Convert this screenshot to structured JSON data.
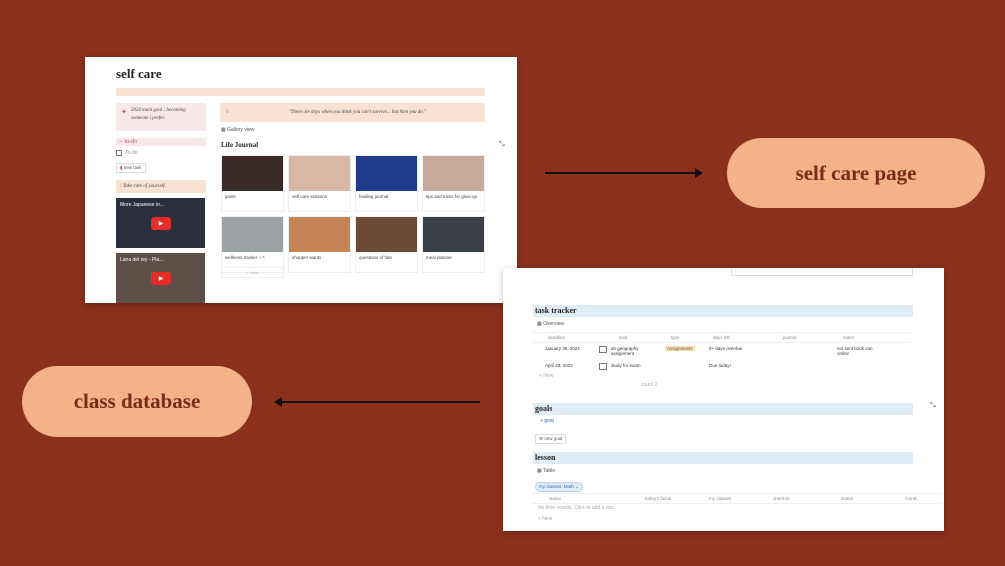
{
  "callouts": {
    "self_care_page": "self care page",
    "class_database": "class database"
  },
  "self_care": {
    "title": "self care",
    "goal_text": "2024 main goal : becoming someone i prefer.",
    "todo_heading": "to-do",
    "todo_item": "To-do",
    "new_task": "new task",
    "take_care": "Take care of yourself.",
    "videos": [
      {
        "title": "More Japanese in..."
      },
      {
        "title": "Lana del rey - Pla..."
      }
    ],
    "quote": "\"There are days when you think you can't survive... but then you do.\"",
    "gallery_view": "Gallery view",
    "life_journal": "Life Journal",
    "gallery": [
      {
        "caption": "goals",
        "color": "#3a2a26"
      },
      {
        "caption": "self care seasons",
        "color": "#d9b7a4"
      },
      {
        "caption": "healing journal",
        "color": "#1f3a8a"
      },
      {
        "caption": "tips and tricks for glow-up",
        "color": "#c7a99a"
      },
      {
        "caption": "wellness tracker ☆*:",
        "color": "#9ca1a3"
      },
      {
        "caption": "shopper wants",
        "color": "#c38456"
      },
      {
        "caption": "questions of fate",
        "color": "#6d4a36"
      },
      {
        "caption": "meal planner",
        "color": "#3b3f48"
      }
    ],
    "new_label": "+ New"
  },
  "class_db": {
    "task_tracker": "task tracker",
    "overview": "Overview",
    "columns": [
      "deadline",
      "task",
      "type",
      "days left",
      "journal",
      "notes"
    ],
    "rows": [
      {
        "deadline": "January 30, 2024",
        "task": "do geography assignment",
        "type": "Assignments",
        "days_left": "8+ days overdue",
        "notes": "not sent book can online"
      },
      {
        "deadline": "April 23, 2024",
        "task": "study for exam",
        "type": "",
        "days_left": "Due today!",
        "notes": ""
      }
    ],
    "new": "+ New",
    "count": "count 2",
    "goals": "goals",
    "goal_link": "+ goal",
    "new_goal": "new goal",
    "lesson": "lesson",
    "table": "Table",
    "filter": "my classes: Math",
    "lesson_columns": [
      "Name",
      "today's focus",
      "my classes",
      "check in",
      "status",
      "month"
    ],
    "empty": "No filter results. Click to add a row.",
    "new2": "+ New"
  },
  "colors": {
    "background": "#8b301d",
    "pill": "#f3b287",
    "pill_text": "#7a2a17"
  },
  "icons": [
    "arrow-right-icon",
    "arrow-left-icon",
    "expand-icon",
    "play-icon",
    "checkbox-icon",
    "table-icon"
  ]
}
